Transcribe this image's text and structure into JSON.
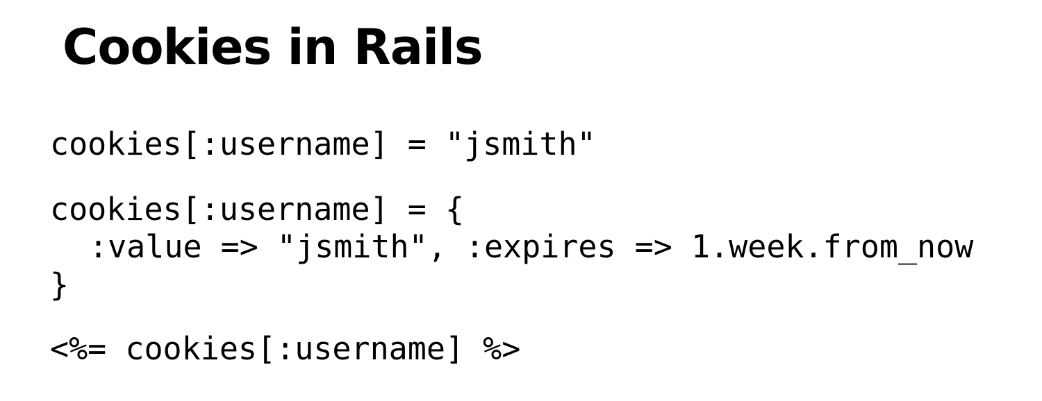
{
  "slide": {
    "title": "Cookies in Rails",
    "code_lines": [
      "cookies[:username] = \"jsmith\"",
      "cookies[:username] = {",
      ":value => \"jsmith\", :expires => 1.week.from_now",
      "}",
      "<%= cookies[:username] %>"
    ]
  },
  "colors": {
    "background": "#ffffff",
    "text": "#000000"
  }
}
